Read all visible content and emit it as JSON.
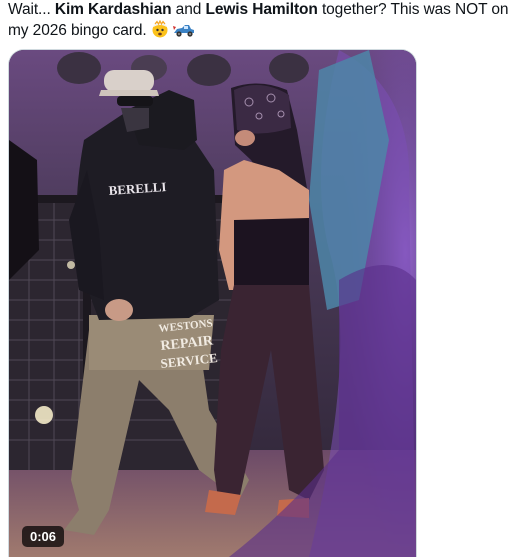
{
  "tweet": {
    "text_pre": "Wait... ",
    "name1": "Kim Kardashian",
    "text_and": " and ",
    "name2": "Lewis Hamilton",
    "text_post": " together? This was NOT on my 2026 bingo card. ",
    "emojis": [
      "shocked-face-icon",
      "racing-car-icon"
    ]
  },
  "video": {
    "timestamp": "0:06",
    "hoodie_text": "BERELLI",
    "pants_text_line1": "WESTONS",
    "pants_text_line2": "REPAIR",
    "pants_text_line3": "SERVICE"
  }
}
